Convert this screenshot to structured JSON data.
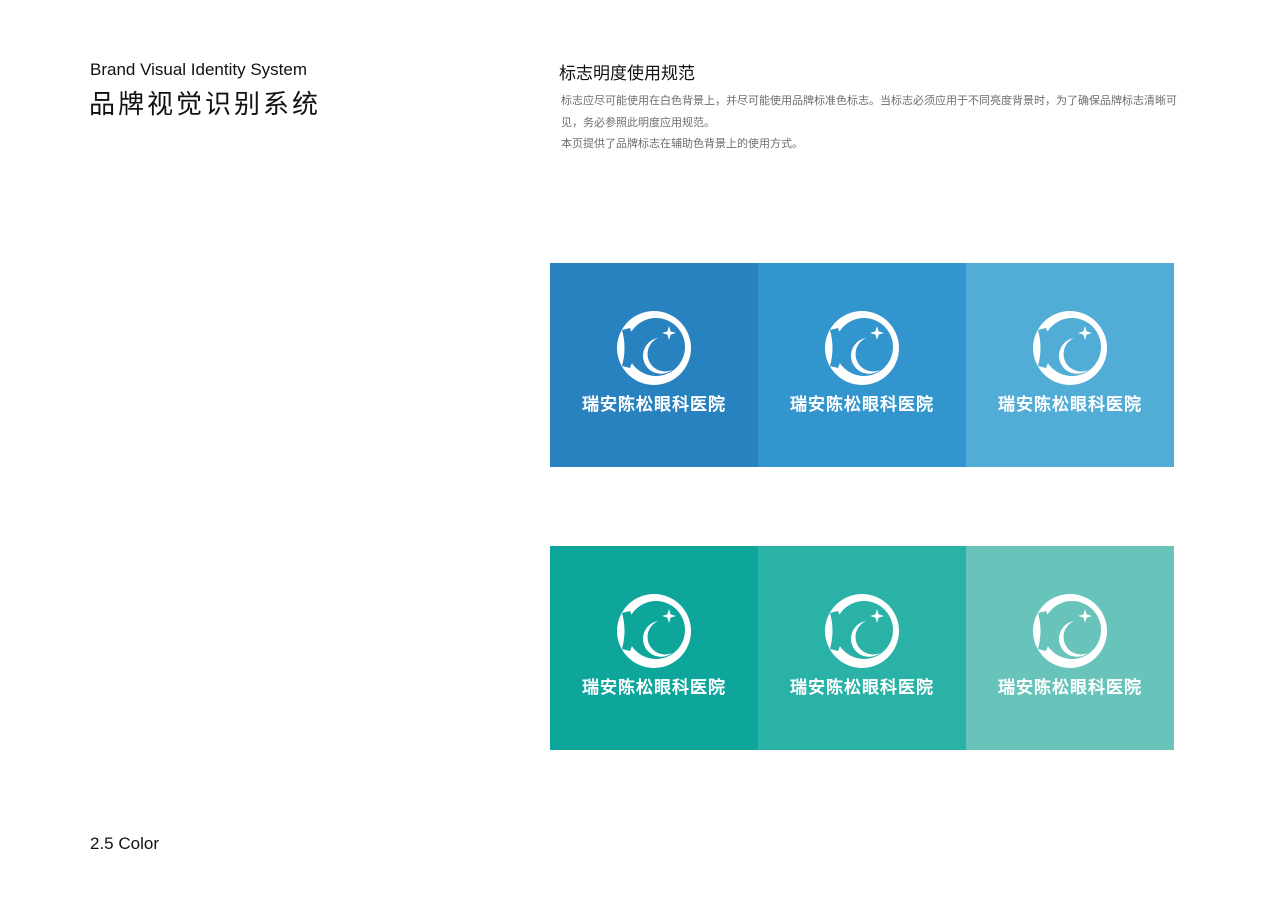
{
  "header": {
    "title_en": "Brand Visual Identity System",
    "title_cn": "品牌视觉识别系统"
  },
  "section": {
    "title": "标志明度使用规范",
    "paragraphs": [
      "标志应尽可能使用在白色背景上，并尽可能使用品牌标准色标志。当标志必须应用于不同亮度背景时，为了确保品牌标志清晰可见，务必参照此明度应用规范。",
      "本页提供了品牌标志在辅助色背景上的使用方式。"
    ]
  },
  "logo": {
    "name": "瑞安陈松眼科医院",
    "mark_icon": "eye-crescent-star-logo-icon"
  },
  "swatches": {
    "blue": [
      "#2882bf",
      "#3395cd",
      "#51acd6"
    ],
    "teal": [
      "#0ea69a",
      "#2ab2a6",
      "#68c4ba"
    ]
  },
  "footer": {
    "page_label": "2.5 Color"
  }
}
